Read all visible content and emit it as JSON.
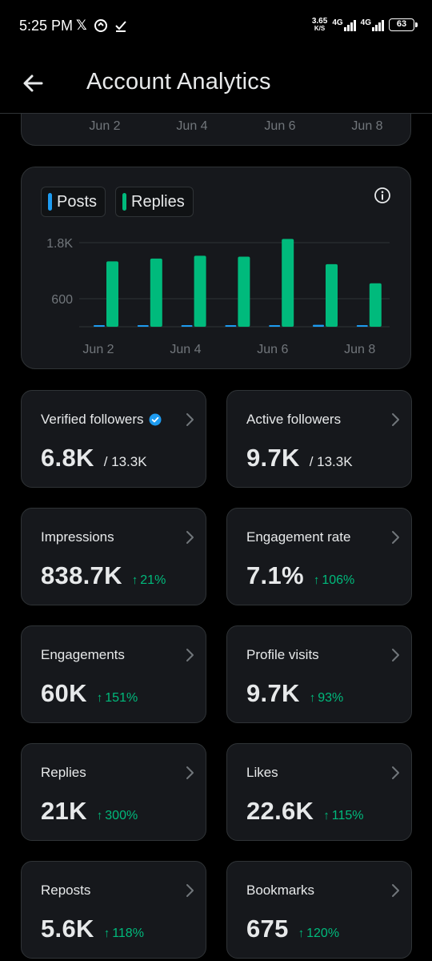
{
  "status_bar": {
    "time": "5:25 PM",
    "speed_value": "3.65",
    "speed_unit": "K/S",
    "network1": "4G",
    "network2": "4G",
    "battery": "63"
  },
  "header": {
    "title": "Account Analytics",
    "back_icon": "arrow-left-icon"
  },
  "top_chart_axis": [
    "Jun 2",
    "Jun 4",
    "Jun 6",
    "Jun 8"
  ],
  "chart_data": {
    "type": "bar",
    "categories": [
      "Jun 2",
      "Jun 3",
      "Jun 4",
      "Jun 5",
      "Jun 6",
      "Jun 7",
      "Jun 8"
    ],
    "x_tick_labels": [
      "Jun 2",
      "Jun 4",
      "Jun 6",
      "Jun 8"
    ],
    "y_tick_labels": [
      "1.8K",
      "600"
    ],
    "y_ticks": [
      1800,
      600
    ],
    "ylim": [
      0,
      2000
    ],
    "legend": [
      "Posts",
      "Replies"
    ],
    "series": [
      {
        "name": "Posts",
        "color": "#1d9bf0",
        "values": [
          10,
          10,
          10,
          20,
          30,
          40,
          30
        ]
      },
      {
        "name": "Replies",
        "color": "#00ba7c",
        "values": [
          1400,
          1460,
          1520,
          1500,
          1880,
          1340,
          930
        ]
      }
    ]
  },
  "stats": [
    {
      "label": "Verified followers",
      "value": "6.8K",
      "sub": "/ 13.3K",
      "verified": true
    },
    {
      "label": "Active followers",
      "value": "9.7K",
      "sub": "/ 13.3K"
    },
    {
      "label": "Impressions",
      "value": "838.7K",
      "change": "21%"
    },
    {
      "label": "Engagement rate",
      "value": "7.1%",
      "change": "106%"
    },
    {
      "label": "Engagements",
      "value": "60K",
      "change": "151%"
    },
    {
      "label": "Profile visits",
      "value": "9.7K",
      "change": "93%"
    },
    {
      "label": "Replies",
      "value": "21K",
      "change": "300%"
    },
    {
      "label": "Likes",
      "value": "22.6K",
      "change": "115%"
    },
    {
      "label": "Reposts",
      "value": "5.6K",
      "change": "118%"
    },
    {
      "label": "Bookmarks",
      "value": "675",
      "change": "120%"
    }
  ],
  "colors": {
    "accent_blue": "#1d9bf0",
    "positive_green": "#00ba7c",
    "card_bg": "#16181c",
    "border": "#2f3336",
    "muted_text": "#71767b"
  }
}
